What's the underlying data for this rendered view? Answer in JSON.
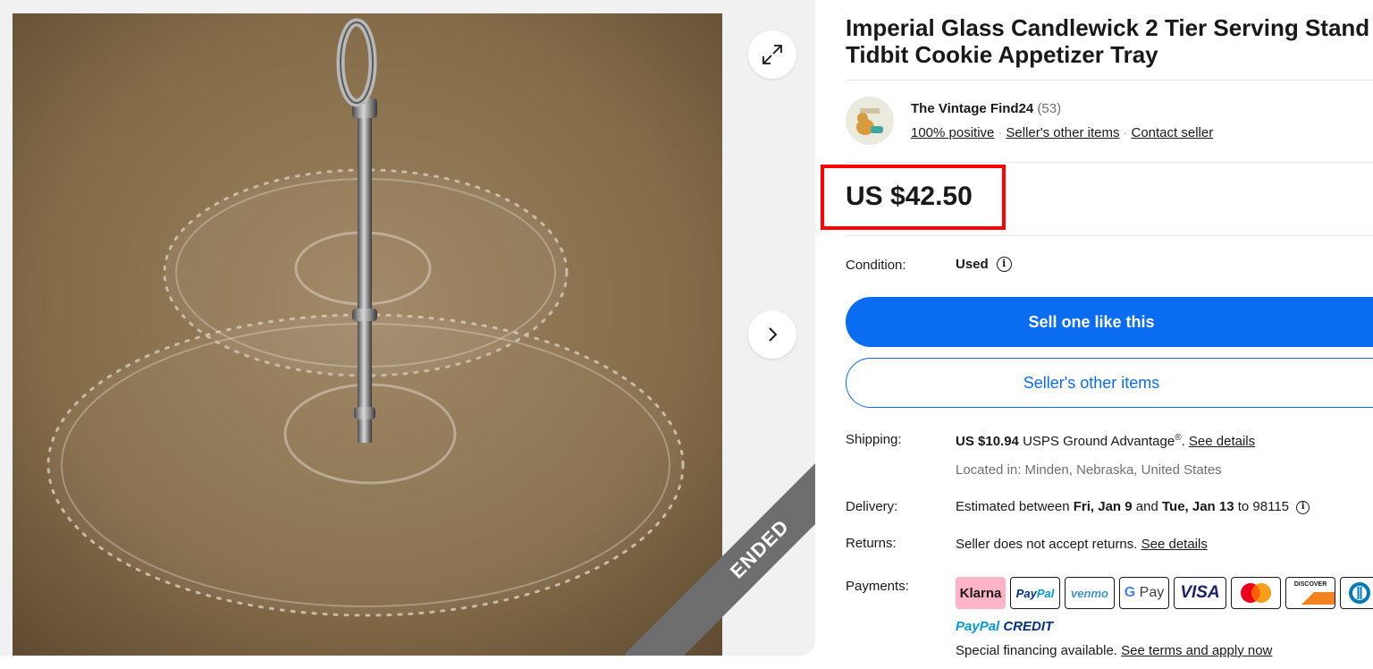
{
  "gallery": {
    "image_alt": "Imperial Glass Candlewick 2 tier serving stand",
    "status_ribbon": "ENDED",
    "expand_icon": "expand-icon",
    "next_icon": "chevron-right-icon"
  },
  "listing": {
    "title": "Imperial Glass Candlewick 2 Tier Serving Stand Tidbit Cookie Appetizer Tray",
    "seller": {
      "name": "The Vintage Find24",
      "feedback_count": "(53)",
      "positive": "100% positive",
      "other_items": "Seller's other items",
      "contact": "Contact seller"
    },
    "price": "US $42.50",
    "condition": {
      "label": "Condition:",
      "value": "Used"
    },
    "buttons": {
      "sell_one": "Sell one like this",
      "seller_other_items": "Seller's other items"
    },
    "shipping": {
      "label": "Shipping:",
      "cost": "US $10.94",
      "service": "USPS Ground Advantage",
      "reg": "®",
      "punct": ".",
      "details_link": "See details",
      "location": "Located in: Minden, Nebraska, United States"
    },
    "delivery": {
      "label": "Delivery:",
      "prefix": "Estimated between",
      "start": "Fri, Jan 9",
      "and": "and",
      "end": "Tue, Jan 13",
      "to": "to 98115"
    },
    "returns": {
      "label": "Returns:",
      "text": "Seller does not accept returns.",
      "details_link": "See details"
    },
    "payments": {
      "label": "Payments:",
      "methods": [
        "Klarna",
        "PayPal",
        "venmo",
        "G Pay",
        "VISA",
        "Mastercard",
        "DISCOVER",
        "Diners Club"
      ],
      "paypal_credit_a": "PayPal",
      "paypal_credit_b": "CREDIT",
      "financing_text": "Special financing available.",
      "financing_link": "See terms and apply now"
    }
  },
  "colors": {
    "primary": "#0a6cf0",
    "highlight_border": "#ff0000",
    "ribbon": "#6e6e6e"
  }
}
